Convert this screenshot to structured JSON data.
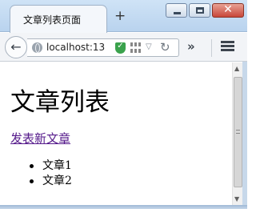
{
  "window": {
    "tab_title": "文章列表页面",
    "new_tab": "+",
    "minimize": "minimize",
    "maximize": "maximize",
    "close": "✕"
  },
  "nav": {
    "back": "←",
    "url": "localhost:13",
    "dropdown": "▽",
    "reload": "↻",
    "overflow": "»"
  },
  "page": {
    "heading": "文章列表",
    "new_article_link": "发表新文章",
    "articles": [
      "文章1",
      "文章2"
    ]
  },
  "colors": {
    "link_visited": "#551a8b",
    "shield_green": "#3aa24c",
    "close_red": "#c8473a"
  }
}
